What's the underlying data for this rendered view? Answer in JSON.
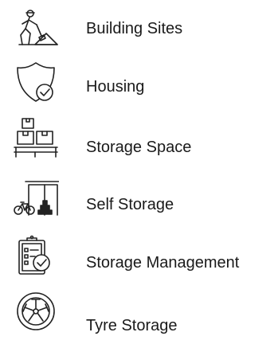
{
  "services": {
    "items": [
      {
        "label": "Building Sites",
        "icon": "construction-worker-icon"
      },
      {
        "label": "Housing",
        "icon": "shield-check-icon"
      },
      {
        "label": "Storage Space",
        "icon": "pallet-boxes-icon"
      },
      {
        "label": "Self Storage",
        "icon": "bicycle-storage-unit-icon"
      },
      {
        "label": "Storage Management",
        "icon": "clipboard-check-icon"
      },
      {
        "label": "Tyre Storage",
        "icon": "tyre-icon"
      }
    ]
  },
  "colors": {
    "icon_stroke": "#222222",
    "text": "#1a1a1a",
    "background": "#ffffff"
  }
}
